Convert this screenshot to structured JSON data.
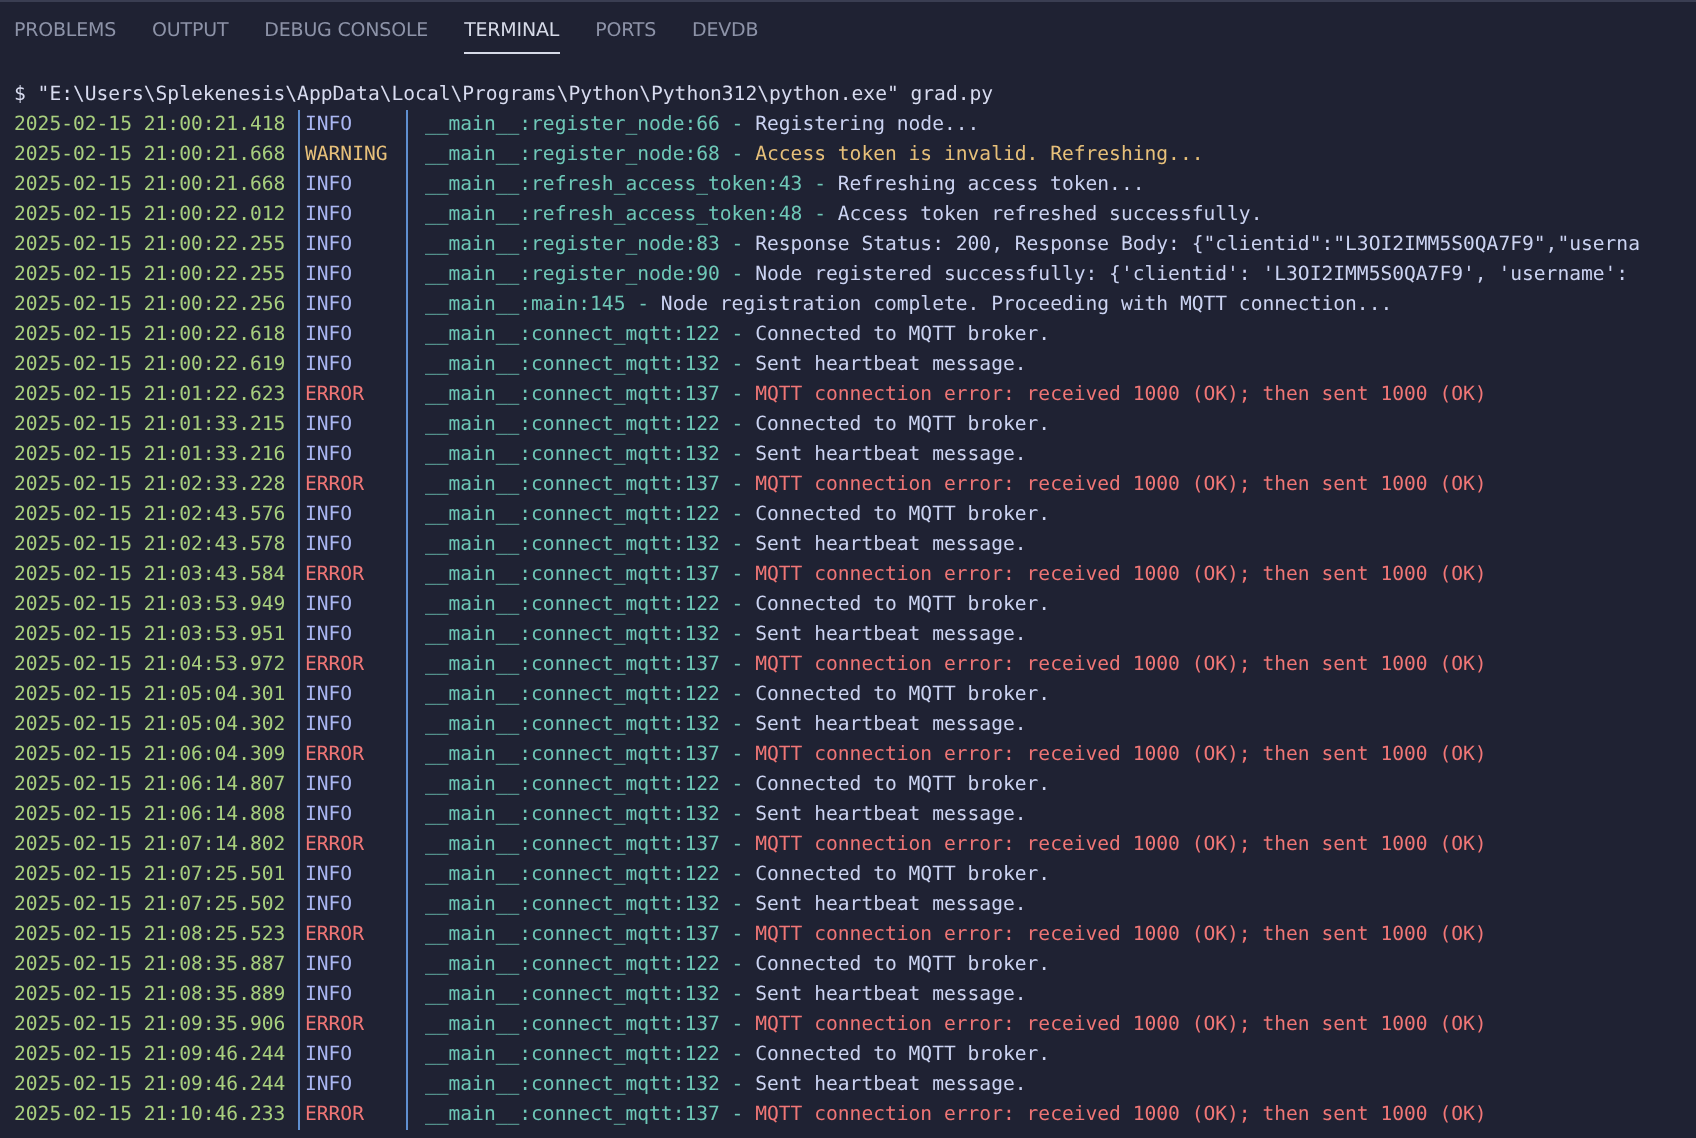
{
  "tabs": [
    {
      "label": "PROBLEMS",
      "selected": false
    },
    {
      "label": "OUTPUT",
      "selected": false
    },
    {
      "label": "DEBUG CONSOLE",
      "selected": false
    },
    {
      "label": "TERMINAL",
      "selected": true
    },
    {
      "label": "PORTS",
      "selected": false
    },
    {
      "label": "DEVDB",
      "selected": false
    }
  ],
  "terminal": {
    "command": "$ \"E:\\Users\\Splekenesis\\AppData\\Local\\Programs\\Python\\Python312\\python.exe\" grad.py",
    "lines": [
      {
        "time": "2025-02-15 21:00:21.418",
        "kind": "info",
        "severity": "INFO",
        "source": "__main__:register_node:66 -",
        "message": "Registering node..."
      },
      {
        "time": "2025-02-15 21:00:21.668",
        "kind": "warning",
        "severity": "WARNING",
        "source": "__main__:register_node:68 -",
        "message": "Access token is invalid. Refreshing..."
      },
      {
        "time": "2025-02-15 21:00:21.668",
        "kind": "info",
        "severity": "INFO",
        "source": "__main__:refresh_access_token:43 -",
        "message": "Refreshing access token..."
      },
      {
        "time": "2025-02-15 21:00:22.012",
        "kind": "info",
        "severity": "INFO",
        "source": "__main__:refresh_access_token:48 -",
        "message": "Access token refreshed successfully."
      },
      {
        "time": "2025-02-15 21:00:22.255",
        "kind": "info",
        "severity": "INFO",
        "source": "__main__:register_node:83 -",
        "message": "Response Status: 200, Response Body: {\"clientid\":\"L3OI2IMM5S0QA7F9\",\"userna"
      },
      {
        "time": "2025-02-15 21:00:22.255",
        "kind": "info",
        "severity": "INFO",
        "source": "__main__:register_node:90 -",
        "message": "Node registered successfully: {'clientid': 'L3OI2IMM5S0QA7F9', 'username':"
      },
      {
        "time": "2025-02-15 21:00:22.256",
        "kind": "info",
        "severity": "INFO",
        "source": "__main__:main:145 -",
        "message": "Node registration complete. Proceeding with MQTT connection..."
      },
      {
        "time": "2025-02-15 21:00:22.618",
        "kind": "info",
        "severity": "INFO",
        "source": "__main__:connect_mqtt:122 -",
        "message": "Connected to MQTT broker."
      },
      {
        "time": "2025-02-15 21:00:22.619",
        "kind": "info",
        "severity": "INFO",
        "source": "__main__:connect_mqtt:132 -",
        "message": "Sent heartbeat message."
      },
      {
        "time": "2025-02-15 21:01:22.623",
        "kind": "error",
        "severity": "ERROR",
        "source": "__main__:connect_mqtt:137 -",
        "message": "MQTT connection error: received 1000 (OK); then sent 1000 (OK)"
      },
      {
        "time": "2025-02-15 21:01:33.215",
        "kind": "info",
        "severity": "INFO",
        "source": "__main__:connect_mqtt:122 -",
        "message": "Connected to MQTT broker."
      },
      {
        "time": "2025-02-15 21:01:33.216",
        "kind": "info",
        "severity": "INFO",
        "source": "__main__:connect_mqtt:132 -",
        "message": "Sent heartbeat message."
      },
      {
        "time": "2025-02-15 21:02:33.228",
        "kind": "error",
        "severity": "ERROR",
        "source": "__main__:connect_mqtt:137 -",
        "message": "MQTT connection error: received 1000 (OK); then sent 1000 (OK)"
      },
      {
        "time": "2025-02-15 21:02:43.576",
        "kind": "info",
        "severity": "INFO",
        "source": "__main__:connect_mqtt:122 -",
        "message": "Connected to MQTT broker."
      },
      {
        "time": "2025-02-15 21:02:43.578",
        "kind": "info",
        "severity": "INFO",
        "source": "__main__:connect_mqtt:132 -",
        "message": "Sent heartbeat message."
      },
      {
        "time": "2025-02-15 21:03:43.584",
        "kind": "error",
        "severity": "ERROR",
        "source": "__main__:connect_mqtt:137 -",
        "message": "MQTT connection error: received 1000 (OK); then sent 1000 (OK)"
      },
      {
        "time": "2025-02-15 21:03:53.949",
        "kind": "info",
        "severity": "INFO",
        "source": "__main__:connect_mqtt:122 -",
        "message": "Connected to MQTT broker."
      },
      {
        "time": "2025-02-15 21:03:53.951",
        "kind": "info",
        "severity": "INFO",
        "source": "__main__:connect_mqtt:132 -",
        "message": "Sent heartbeat message."
      },
      {
        "time": "2025-02-15 21:04:53.972",
        "kind": "error",
        "severity": "ERROR",
        "source": "__main__:connect_mqtt:137 -",
        "message": "MQTT connection error: received 1000 (OK); then sent 1000 (OK)"
      },
      {
        "time": "2025-02-15 21:05:04.301",
        "kind": "info",
        "severity": "INFO",
        "source": "__main__:connect_mqtt:122 -",
        "message": "Connected to MQTT broker."
      },
      {
        "time": "2025-02-15 21:05:04.302",
        "kind": "info",
        "severity": "INFO",
        "source": "__main__:connect_mqtt:132 -",
        "message": "Sent heartbeat message."
      },
      {
        "time": "2025-02-15 21:06:04.309",
        "kind": "error",
        "severity": "ERROR",
        "source": "__main__:connect_mqtt:137 -",
        "message": "MQTT connection error: received 1000 (OK); then sent 1000 (OK)"
      },
      {
        "time": "2025-02-15 21:06:14.807",
        "kind": "info",
        "severity": "INFO",
        "source": "__main__:connect_mqtt:122 -",
        "message": "Connected to MQTT broker."
      },
      {
        "time": "2025-02-15 21:06:14.808",
        "kind": "info",
        "severity": "INFO",
        "source": "__main__:connect_mqtt:132 -",
        "message": "Sent heartbeat message."
      },
      {
        "time": "2025-02-15 21:07:14.802",
        "kind": "error",
        "severity": "ERROR",
        "source": "__main__:connect_mqtt:137 -",
        "message": "MQTT connection error: received 1000 (OK); then sent 1000 (OK)"
      },
      {
        "time": "2025-02-15 21:07:25.501",
        "kind": "info",
        "severity": "INFO",
        "source": "__main__:connect_mqtt:122 -",
        "message": "Connected to MQTT broker."
      },
      {
        "time": "2025-02-15 21:07:25.502",
        "kind": "info",
        "severity": "INFO",
        "source": "__main__:connect_mqtt:132 -",
        "message": "Sent heartbeat message."
      },
      {
        "time": "2025-02-15 21:08:25.523",
        "kind": "error",
        "severity": "ERROR",
        "source": "__main__:connect_mqtt:137 -",
        "message": "MQTT connection error: received 1000 (OK); then sent 1000 (OK)"
      },
      {
        "time": "2025-02-15 21:08:35.887",
        "kind": "info",
        "severity": "INFO",
        "source": "__main__:connect_mqtt:122 -",
        "message": "Connected to MQTT broker."
      },
      {
        "time": "2025-02-15 21:08:35.889",
        "kind": "info",
        "severity": "INFO",
        "source": "__main__:connect_mqtt:132 -",
        "message": "Sent heartbeat message."
      },
      {
        "time": "2025-02-15 21:09:35.906",
        "kind": "error",
        "severity": "ERROR",
        "source": "__main__:connect_mqtt:137 -",
        "message": "MQTT connection error: received 1000 (OK); then sent 1000 (OK)"
      },
      {
        "time": "2025-02-15 21:09:46.244",
        "kind": "info",
        "severity": "INFO",
        "source": "__main__:connect_mqtt:122 -",
        "message": "Connected to MQTT broker."
      },
      {
        "time": "2025-02-15 21:09:46.244",
        "kind": "info",
        "severity": "INFO",
        "source": "__main__:connect_mqtt:132 -",
        "message": "Sent heartbeat message."
      },
      {
        "time": "2025-02-15 21:10:46.233",
        "kind": "error",
        "severity": "ERROR",
        "source": "__main__:connect_mqtt:137 -",
        "message": "MQTT connection error: received 1000 (OK); then sent 1000 (OK)"
      }
    ]
  }
}
